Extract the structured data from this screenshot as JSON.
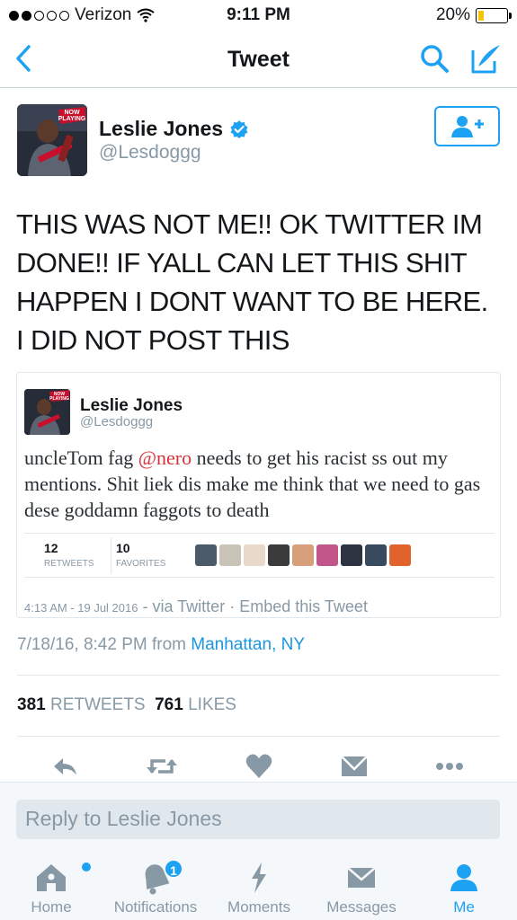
{
  "status_bar": {
    "carrier": "Verizon",
    "time": "9:11 PM",
    "battery": "20%",
    "battery_level": 0.2
  },
  "nav": {
    "title": "Tweet",
    "back_icon": "chevron-left-icon",
    "search_icon": "search-icon",
    "compose_icon": "compose-icon"
  },
  "tweet": {
    "author_name": "Leslie Jones",
    "author_handle": "@Lesdoggg",
    "avatar_badge_line1": "NOW",
    "avatar_badge_line2": "PLAYING",
    "text": "THIS WAS NOT ME!! OK TWITTER IM DONE!! IF YALL CAN LET THIS SHIT HAPPEN I DONT WANT TO BE HERE. I DID NOT POST THIS",
    "date_prefix": "7/18/16, 8:42 PM from",
    "location": "Manhattan, NY",
    "retweets_count": "381",
    "retweets_label": "RETWEETS",
    "likes_count": "761",
    "likes_label": "LIKES"
  },
  "quoted": {
    "author_name": "Leslie Jones",
    "author_handle": "@Lesdoggg",
    "avatar_badge_line1": "NOW",
    "avatar_badge_line2": "PLAYING",
    "text_before": "uncleTom fag ",
    "mention": "@nero",
    "text_after": " needs to get his racist ss out my mentions. Shit liek dis make me think that we need to gas dese goddamn faggots to death",
    "retweets_count": "12",
    "retweets_label": "RETWEETS",
    "favorites_count": "10",
    "favorites_label": "FAVORITES",
    "timestamp": "4:13 AM - 19 Jul 2016",
    "via": "- via Twitter",
    "embed": "· Embed this Tweet"
  },
  "reply": {
    "placeholder": "Reply to Leslie Jones"
  },
  "tabs": [
    {
      "label": "Home",
      "icon": "home-icon"
    },
    {
      "label": "Notifications",
      "icon": "bell-icon",
      "badge": "1"
    },
    {
      "label": "Moments",
      "icon": "lightning-icon"
    },
    {
      "label": "Messages",
      "icon": "envelope-icon"
    },
    {
      "label": "Me",
      "icon": "person-icon"
    }
  ],
  "colors": {
    "accent": "#1da1f2",
    "mention": "#d6323a",
    "muted": "#8899a6"
  }
}
